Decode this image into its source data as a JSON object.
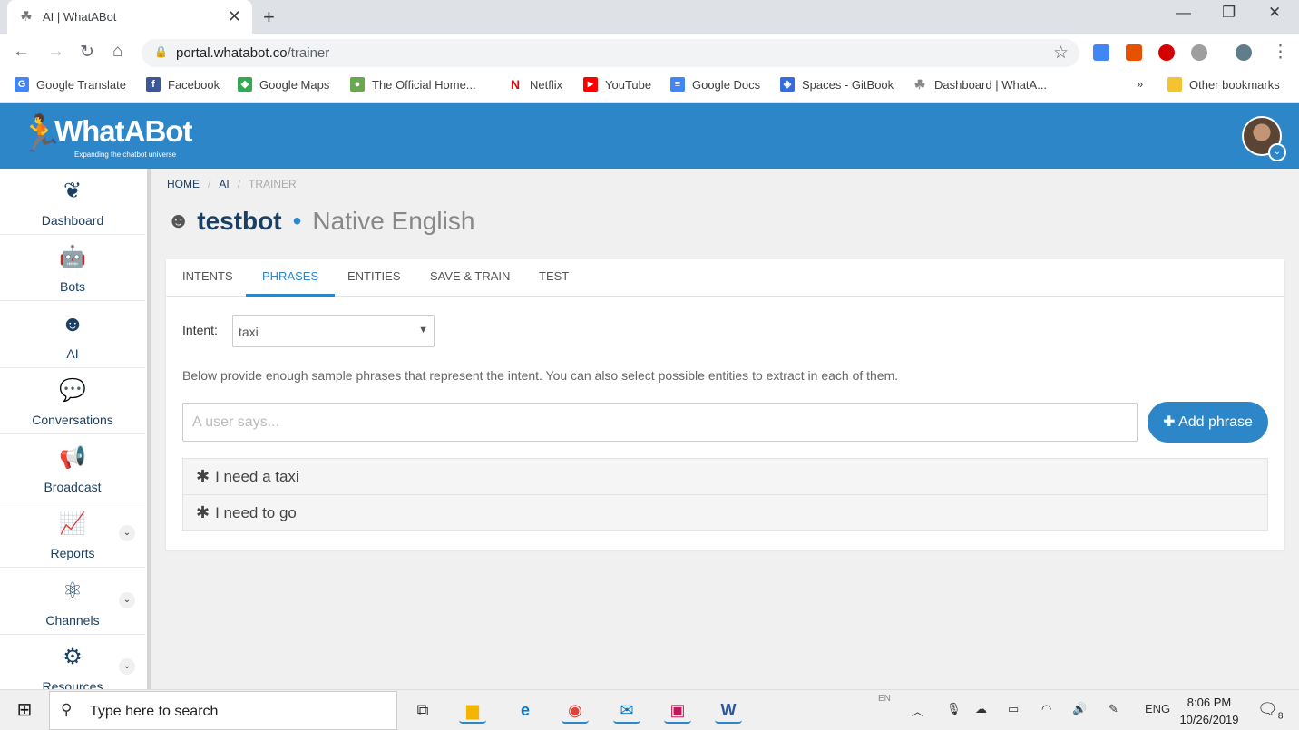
{
  "browser": {
    "tab_title": "AI | WhatABot",
    "tab_close": "✕",
    "new_tab": "+",
    "url_host": "portal.whatabot.co",
    "url_path": "/trainer",
    "bookmarks": [
      {
        "label": "Google Translate",
        "icon": "google-translate-icon",
        "color": "#4285f4"
      },
      {
        "label": "Facebook",
        "icon": "facebook-icon",
        "color": "#3b5998"
      },
      {
        "label": "Google Maps",
        "icon": "google-maps-icon",
        "color": "#34a853"
      },
      {
        "label": "The Official Home...",
        "icon": "official-home-icon",
        "color": "#6aa84f"
      },
      {
        "label": "Netflix",
        "icon": "netflix-icon",
        "color": "#e50914"
      },
      {
        "label": "YouTube",
        "icon": "youtube-icon",
        "color": "#ff0000"
      },
      {
        "label": "Google Docs",
        "icon": "google-docs-icon",
        "color": "#4285f4"
      },
      {
        "label": "Spaces - GitBook",
        "icon": "gitbook-icon",
        "color": "#346ddb"
      },
      {
        "label": "Dashboard | WhatA...",
        "icon": "whatabot-icon",
        "color": "#888888"
      }
    ],
    "bookmarks_overflow": "»",
    "other_bookmarks": "Other bookmarks"
  },
  "app": {
    "brand": "WhatABot",
    "tagline": "Expanding the chatbot universe",
    "accent": "#2d86c8",
    "navy": "#1b3f63"
  },
  "sidebar": {
    "items": [
      {
        "label": "Dashboard",
        "icon": "dashboard-icon",
        "glyph": "❦"
      },
      {
        "label": "Bots",
        "icon": "robot-icon",
        "glyph": "🤖"
      },
      {
        "label": "AI",
        "icon": "brain-head-icon",
        "glyph": "☻"
      },
      {
        "label": "Conversations",
        "icon": "chat-bubbles-icon",
        "glyph": "💬"
      },
      {
        "label": "Broadcast",
        "icon": "megaphone-icon",
        "glyph": "📢"
      },
      {
        "label": "Reports",
        "icon": "chart-line-icon",
        "glyph": "📈"
      },
      {
        "label": "Channels",
        "icon": "network-icon",
        "glyph": "⚛"
      },
      {
        "label": "Resources",
        "icon": "gear-icon",
        "glyph": "⚙"
      }
    ]
  },
  "breadcrumb": {
    "home": "HOME",
    "ai": "AI",
    "current": "TRAINER",
    "separator": "/"
  },
  "page": {
    "bot_name": "testbot",
    "dot": "•",
    "language": "Native English"
  },
  "tabs": [
    {
      "label": "INTENTS",
      "active": false
    },
    {
      "label": "PHRASES",
      "active": true
    },
    {
      "label": "ENTITIES",
      "active": false
    },
    {
      "label": "SAVE & TRAIN",
      "active": false
    },
    {
      "label": "TEST",
      "active": false
    }
  ],
  "phrases_form": {
    "intent_label": "Intent:",
    "intent_value": "taxi",
    "description": "Below provide enough sample phrases that represent the intent. You can also select possible entities to extract in each of them.",
    "input_placeholder": "A user says...",
    "add_button": "Add phrase",
    "phrases": [
      "I need a taxi",
      "I need to go"
    ]
  },
  "taskbar": {
    "search_text": "Type here to search",
    "lang_indicator": "EN",
    "input_lang": "ENG",
    "time": "8:06 PM",
    "date": "10/26/2019",
    "notification_count": "8"
  }
}
